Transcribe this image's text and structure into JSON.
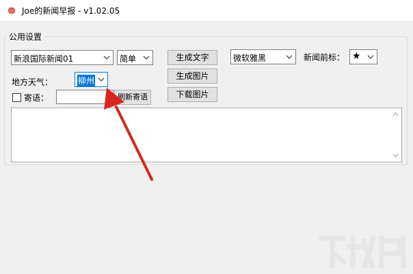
{
  "window": {
    "title": "Joe的新闻早报 - v1.02.05",
    "icon": "strawberry-icon"
  },
  "settings": {
    "group_label": "公用设置",
    "news_source": "新浪国际新闻01",
    "script_mode": "简单",
    "font": "微软雅黑",
    "headline_prefix_label": "新闻前标：",
    "headline_prefix_symbol": "★",
    "weather_label": "地方天气：",
    "weather_city": "柳州",
    "message_label": "寄语：",
    "message_value": ""
  },
  "buttons": {
    "generate_text": "生成文字",
    "generate_image": "生成图片",
    "download_image": "下载图片",
    "refresh_message": "刷新寄语"
  },
  "output": {
    "text": ""
  },
  "colors": {
    "focus": "#0078d7",
    "annotation_arrow": "#d9251d"
  }
}
